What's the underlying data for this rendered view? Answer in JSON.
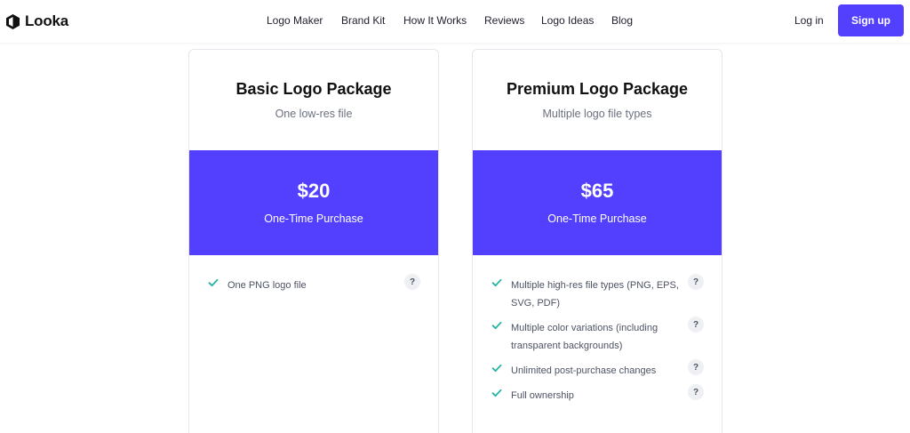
{
  "brand": {
    "name": "Looka",
    "icon": "looka-logo-icon"
  },
  "nav": {
    "links": [
      "Logo Maker",
      "Brand Kit",
      "How It Works",
      "Reviews",
      "Logo Ideas",
      "Blog"
    ],
    "login": "Log in",
    "signup": "Sign up"
  },
  "colors": {
    "accent": "#5340ff",
    "check": "#22b4a0"
  },
  "packages": [
    {
      "title": "Basic Logo Package",
      "subtitle": "One low-res file",
      "price": "$20",
      "price_label": "One-Time Purchase",
      "features": [
        {
          "text": "One PNG logo file",
          "help": "?"
        }
      ]
    },
    {
      "title": "Premium Logo Package",
      "subtitle": "Multiple logo file types",
      "price": "$65",
      "price_label": "One-Time Purchase",
      "features": [
        {
          "text": "Multiple high-res file types (PNG, EPS, SVG, PDF)",
          "help": "?"
        },
        {
          "text": "Multiple color variations (including transparent backgrounds)",
          "help": "?"
        },
        {
          "text": "Unlimited post-purchase changes",
          "help": "?"
        },
        {
          "text": "Full ownership",
          "help": "?"
        }
      ]
    }
  ]
}
